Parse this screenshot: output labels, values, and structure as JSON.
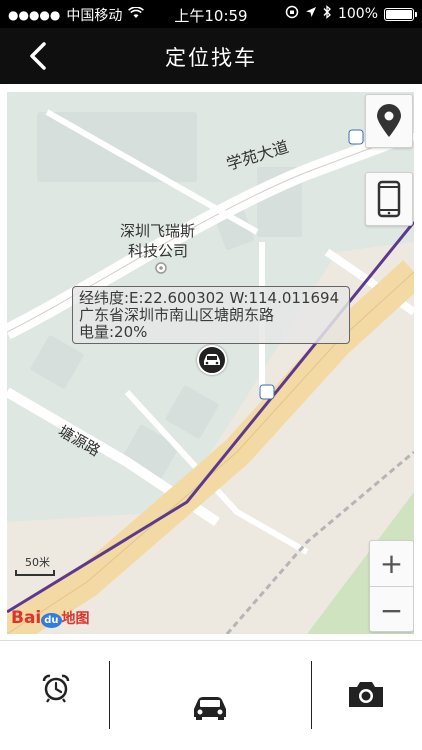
{
  "status_bar": {
    "signal_dots": "●●●●●",
    "carrier": "中国移动",
    "time": "上午10:59",
    "battery_percent": "100%",
    "battery_level": 1.0
  },
  "nav": {
    "title": "定位找车"
  },
  "map": {
    "road_labels": {
      "xueyuan": "学苑大道",
      "tangyuan": "塘源路"
    },
    "poi_label_line1": "深圳飞瑞斯",
    "poi_label_line2": "科技公司",
    "scale_text": "50米",
    "logo": {
      "bai": "Bai",
      "du": "du",
      "ditu": "地图"
    }
  },
  "info_box": {
    "coords": "经纬度:E:22.600302 W:114.011694",
    "address": "广东省深圳市南山区塘朗东路",
    "battery": "电量:20%"
  },
  "map_controls": {
    "zoom_in": "+",
    "zoom_out": "−"
  },
  "icons": {
    "back": "chevron-left-icon",
    "location": "location-pin-icon",
    "phone": "phone-icon",
    "alarm": "alarm-clock-icon",
    "car": "car-icon",
    "camera": "camera-icon"
  },
  "colors": {
    "route": "#5b3a8e",
    "highway": "#f3d9a3",
    "building_area": "#dfe7e3"
  }
}
